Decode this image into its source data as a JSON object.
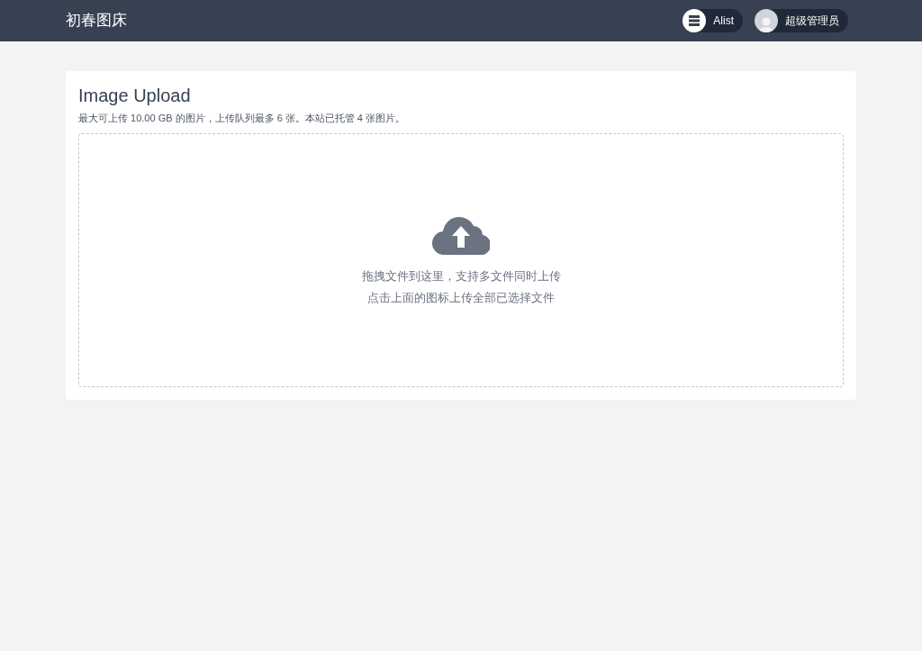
{
  "header": {
    "brand": "初春图床",
    "links": [
      {
        "kind": "storage",
        "label": "Alist"
      },
      {
        "kind": "user",
        "label": "超级管理员"
      }
    ]
  },
  "upload": {
    "title": "Image Upload",
    "info": "最大可上传 10.00 GB 的图片，上传队列最多 6 张。本站已托管 4 张图片。",
    "hints": [
      "拖拽文件到这里，支持多文件同时上传",
      "点击上面的图标上传全部已选择文件"
    ]
  }
}
